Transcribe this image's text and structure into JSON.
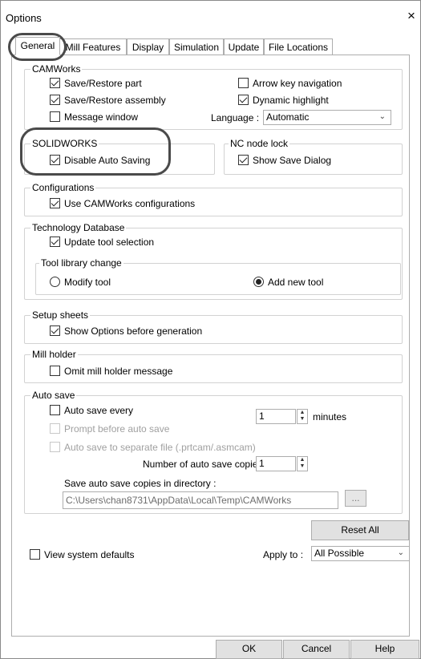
{
  "window": {
    "title": "Options",
    "close_glyph": "×"
  },
  "tabs": [
    {
      "label": "General"
    },
    {
      "label": "Mill Features"
    },
    {
      "label": "Display"
    },
    {
      "label": "Simulation"
    },
    {
      "label": "Update"
    },
    {
      "label": "File Locations"
    }
  ],
  "camworks": {
    "label": "CAMWorks",
    "save_restore_part": {
      "label": "Save/Restore part",
      "checked": true
    },
    "save_restore_assembly": {
      "label": "Save/Restore assembly",
      "checked": true
    },
    "message_window": {
      "label": "Message window",
      "checked": false
    },
    "arrow_key_navigation": {
      "label": "Arrow key navigation",
      "checked": false
    },
    "dynamic_highlight": {
      "label": "Dynamic highlight",
      "checked": true
    },
    "language_label": "Language :",
    "language_value": "Automatic"
  },
  "solidworks": {
    "label": "SOLIDWORKS",
    "disable_auto_saving": {
      "label": "Disable Auto Saving",
      "checked": true
    }
  },
  "nc_node_lock": {
    "label": "NC node lock",
    "show_save_dialog": {
      "label": "Show Save Dialog",
      "checked": true
    }
  },
  "configurations": {
    "label": "Configurations",
    "use_camworks_configurations": {
      "label": "Use CAMWorks configurations",
      "checked": true
    }
  },
  "technology_database": {
    "label": "Technology Database",
    "update_tool_selection": {
      "label": "Update tool selection",
      "checked": true
    },
    "tool_library_change": {
      "label": "Tool library change",
      "modify_tool": {
        "label": "Modify tool",
        "selected": false
      },
      "add_new_tool": {
        "label": "Add new tool",
        "selected": true
      }
    }
  },
  "setup_sheets": {
    "label": "Setup sheets",
    "show_options_before_generation": {
      "label": "Show Options before generation",
      "checked": true
    }
  },
  "mill_holder": {
    "label": "Mill holder",
    "omit_mill_holder_message": {
      "label": "Omit mill holder message",
      "checked": false
    }
  },
  "auto_save": {
    "label": "Auto save",
    "auto_save_every": {
      "label": "Auto save every",
      "checked": false
    },
    "interval_value": "1",
    "interval_unit": "minutes",
    "prompt_before_auto_save": {
      "label": "Prompt before auto save",
      "checked": false
    },
    "auto_save_separate_file": {
      "label": "Auto save to separate file (.prtcam/.asmcam)",
      "checked": false
    },
    "copies_label": "Number of auto save copies:",
    "copies_value": "1",
    "directory_label": "Save auto save copies in directory :",
    "directory_value": "C:\\Users\\chan8731\\AppData\\Local\\Temp\\CAMWorks",
    "browse_label": "..."
  },
  "reset_all_label": "Reset All",
  "view_system_defaults": {
    "label": "View system defaults",
    "checked": false
  },
  "apply_to": {
    "label": "Apply to :",
    "value": "All Possible"
  },
  "footer": {
    "ok": "OK",
    "cancel": "Cancel",
    "help": "Help"
  },
  "icons": {
    "chevron": "chevron-down-icon",
    "close": "close-icon"
  }
}
